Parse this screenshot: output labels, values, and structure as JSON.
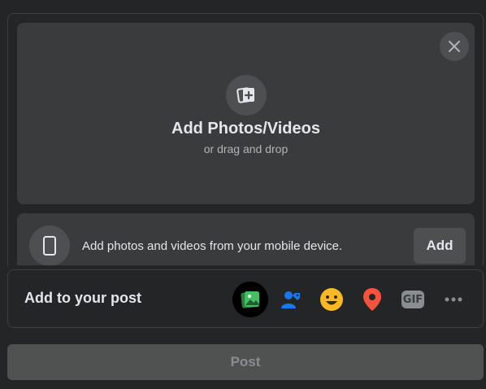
{
  "dropzone": {
    "title": "Add Photos/Videos",
    "subtitle": "or drag and drop",
    "close_icon": "close-icon",
    "add_icon": "photo-add-icon"
  },
  "mobile": {
    "text": "Add photos and videos from your mobile device.",
    "add_label": "Add",
    "icon": "phone-icon"
  },
  "add_to_post": {
    "label": "Add to your post",
    "icons": [
      "photo-video-icon",
      "tag-people-icon",
      "feeling-icon",
      "check-in-icon",
      "gif-icon",
      "more-icon"
    ],
    "gif_text": "GIF",
    "active": "photo-video-icon"
  },
  "post_button": {
    "label": "Post",
    "enabled": false
  },
  "colors": {
    "background": "#242526",
    "surface": "#3a3b3c",
    "photo_green": "#45bd62",
    "tag_blue": "#1877f2",
    "feeling_yellow": "#f7b928",
    "checkin_red": "#f5533d"
  }
}
